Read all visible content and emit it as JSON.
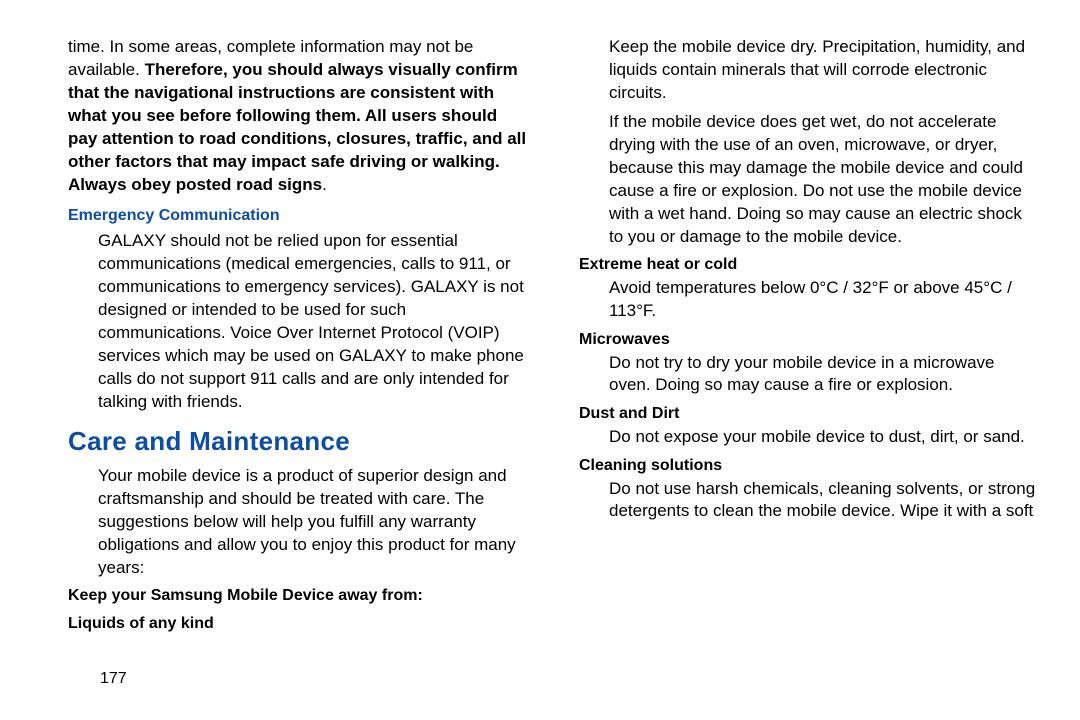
{
  "left": {
    "intro_pre": "time. In some areas, complete information may not be available. ",
    "intro_bold": "Therefore, you should always visually confirm that the navigational instructions are consistent with what you see before following them. All users should pay attention to road conditions, closures, traffic, and all other factors that may impact safe driving or walking. Always obey posted road signs",
    "intro_post": ".",
    "emergency_heading": "Emergency Communication",
    "emergency_body": "GALAXY should not be relied upon for essential communications (medical emergencies, calls to 911, or communications to emergency services). GALAXY is not designed or intended to be used for such communications. Voice Over Internet Protocol (VOIP) services which may be used on GALAXY to make phone calls do not support 911 calls and are only intended for talking with friends.",
    "care_heading": "Care and Maintenance",
    "care_body": "Your mobile device is a product of superior design and craftsmanship and should be treated with care. The suggestions below will help you fulfill any warranty obligations and allow you to enjoy this product for many years:"
  },
  "right": {
    "keep_away_heading": "Keep your Samsung Mobile Device away from:",
    "liquids_title": "Liquids of any kind",
    "liquids_p1": "Keep the mobile device dry. Precipitation, humidity, and liquids contain minerals that will corrode electronic circuits.",
    "liquids_p2": "If the mobile device does get wet, do not accelerate drying with the use of an oven, microwave, or dryer, because this may damage the mobile device and could cause a fire or explosion. Do not use the mobile device with a wet hand. Doing so may cause an electric shock to you or damage to the mobile device.",
    "heat_title": "Extreme heat or cold",
    "heat_body": "Avoid temperatures below 0°C / 32°F or above 45°C / 113°F.",
    "microwave_title": "Microwaves",
    "microwave_body": "Do not try to dry your mobile device in a microwave oven. Doing so may cause a fire or explosion.",
    "dust_title": "Dust and Dirt",
    "dust_body": "Do not expose your mobile device to dust, dirt, or sand.",
    "cleaning_title": "Cleaning solutions",
    "cleaning_body": "Do not use harsh chemicals, cleaning solvents, or strong detergents to clean the mobile device. Wipe it with a soft"
  },
  "page_number": "177"
}
